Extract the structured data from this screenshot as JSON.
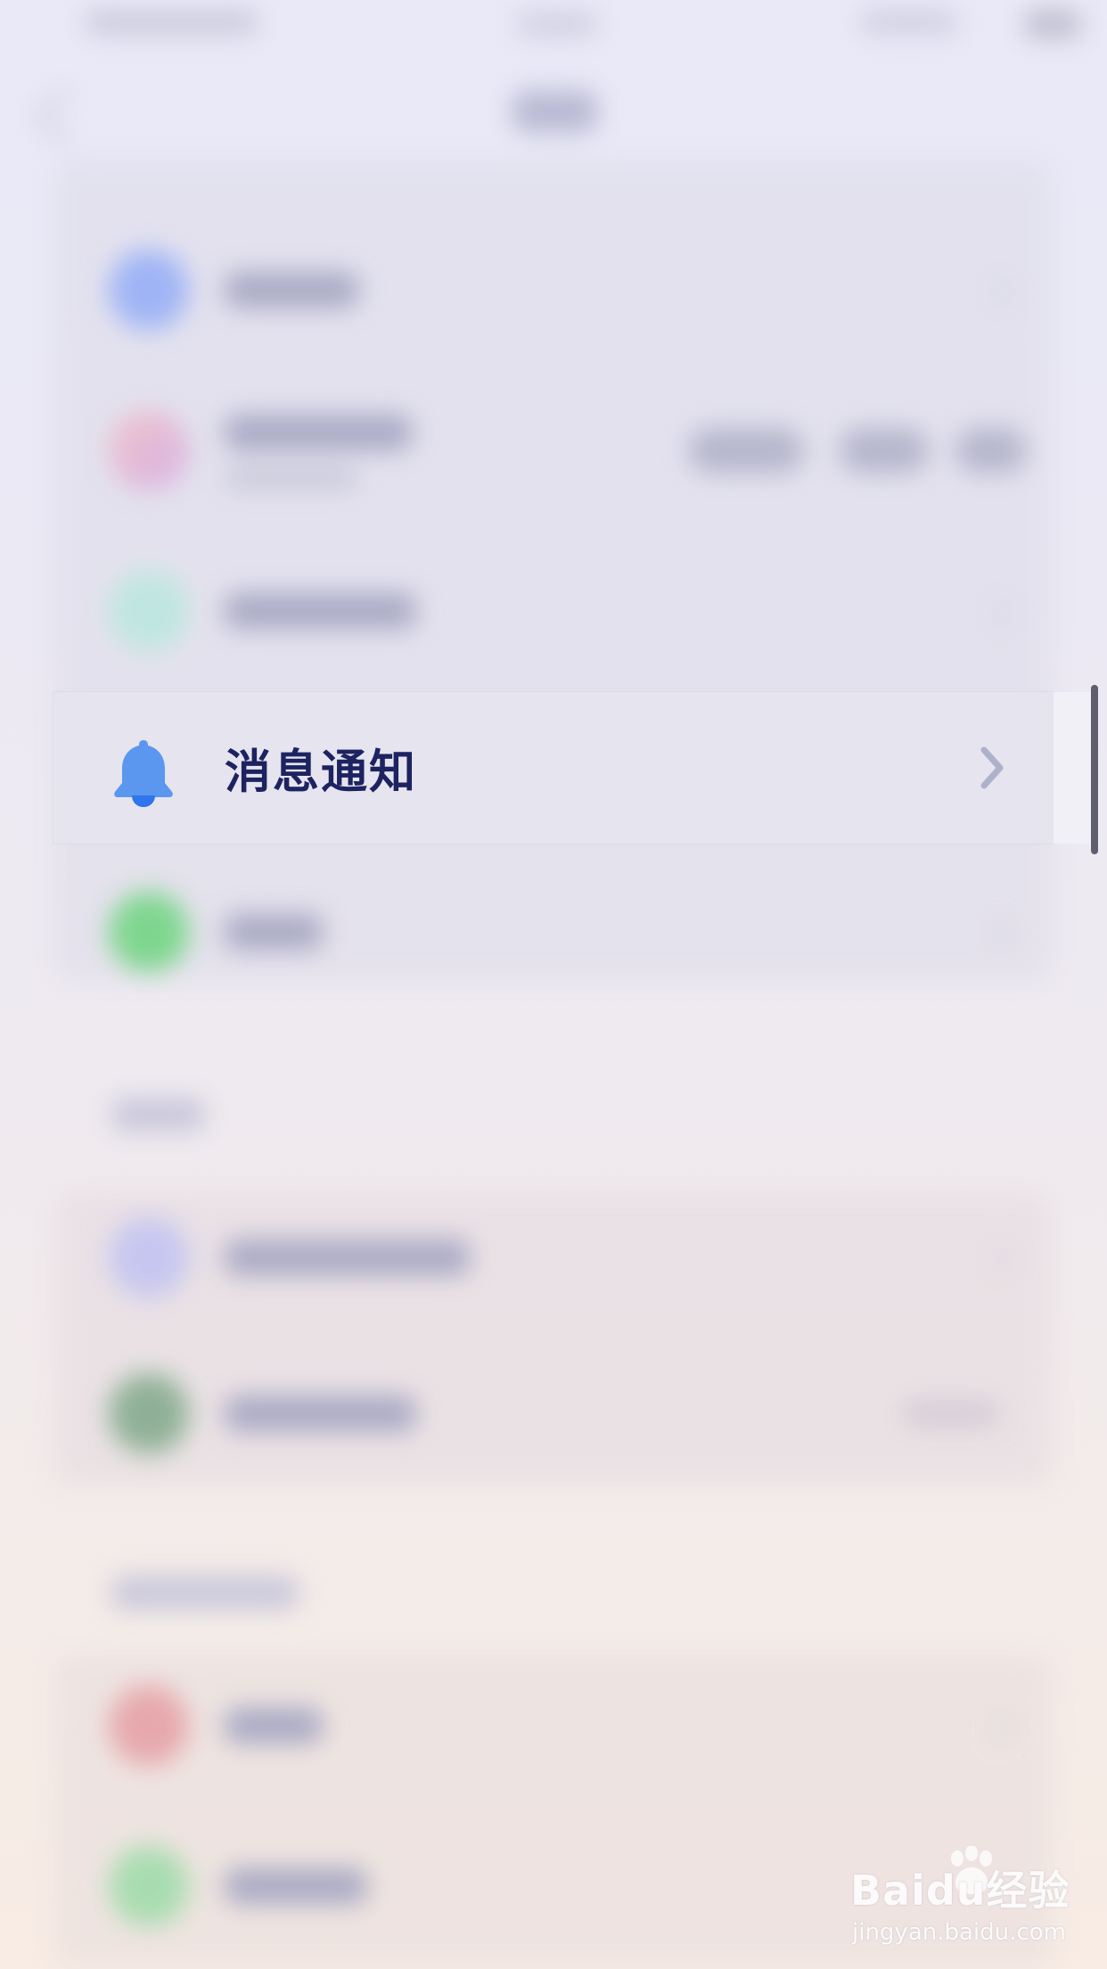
{
  "settings": {
    "focused_row": {
      "label": "消息通知",
      "icon": "bell-icon",
      "chevron": "chevron-right-icon",
      "icon_color": "#4a8cf0",
      "icon_accent": "#2f76ee",
      "label_color": "#1d2360"
    }
  },
  "watermark": {
    "brand": "Baidu经验",
    "url": "jingyan.baidu.com"
  }
}
